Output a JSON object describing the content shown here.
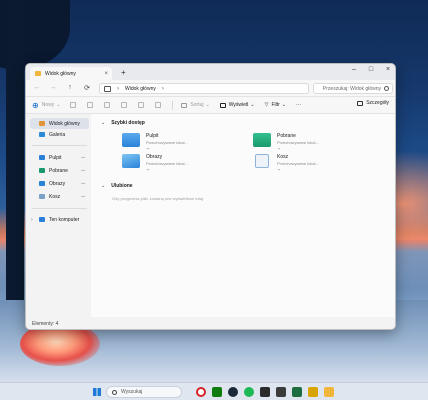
{
  "window": {
    "tab_title": "Widok główny",
    "nav": {
      "back": "←",
      "forward": "→",
      "up": "↑",
      "refresh": "⟳"
    },
    "address": {
      "segment": "Widok główny"
    },
    "search_placeholder": "Przeszukaj: Widok główny"
  },
  "toolbar": {
    "new_label": "Nowy",
    "sort_label": "Sortuj",
    "view_label": "Wyświetl",
    "filter_label": "Filtr",
    "more_label": "···",
    "details_label": "Szczegóły"
  },
  "sidebar": {
    "items": [
      {
        "label": "Widok główny",
        "icon": "home-icon",
        "color": "#e0953a"
      },
      {
        "label": "Galeria",
        "icon": "gallery-icon",
        "color": "#2b8bd6"
      },
      {
        "label": "Pulpit",
        "icon": "desktop-icon",
        "color": "#2a82d8"
      },
      {
        "label": "Pobrane",
        "icon": "download-icon",
        "color": "#1a9a6c"
      },
      {
        "label": "Obrazy",
        "icon": "pictures-icon",
        "color": "#2a82d8"
      },
      {
        "label": "Kosz",
        "icon": "recycle-bin-icon",
        "color": "#7aa0c8"
      },
      {
        "label": "Ten komputer",
        "icon": "computer-icon",
        "color": "#2a82d8"
      }
    ]
  },
  "main": {
    "quick_access": {
      "title": "Szybki dostęp",
      "items": [
        {
          "name": "Pulpit",
          "sub": "Przechowywane lokal...",
          "color": "#2a82d8"
        },
        {
          "name": "Pobrane",
          "sub": "Przechowywane lokal...",
          "color": "#1a9a6c"
        },
        {
          "name": "Obrazy",
          "sub": "Przechowywane lokal...",
          "color": "#2a82d8"
        },
        {
          "name": "Kosz",
          "sub": "Przechowywane lokal...",
          "color": "#8fb4da"
        }
      ],
      "pin_glyph": "⊸"
    },
    "favorites": {
      "title": "Ulubione",
      "empty_text": "Gdy przypniesz pliki, zostaną one wyświetlone tutaj."
    }
  },
  "status": {
    "text": "Elementy: 4"
  },
  "taskbar": {
    "search_placeholder": "Wyszukaj",
    "apps": [
      {
        "name": "opera-icon",
        "color": "#d8232a"
      },
      {
        "name": "xbox-icon",
        "color": "#107c10"
      },
      {
        "name": "steam-icon",
        "color": "#1b2838"
      },
      {
        "name": "spotify-icon",
        "color": "#1db954"
      },
      {
        "name": "app-icon",
        "color": "#2b2b2b"
      },
      {
        "name": "excel-icon",
        "color": "#1d6f42"
      },
      {
        "name": "tool-icon",
        "color": "#d9a400"
      },
      {
        "name": "file-explorer-icon",
        "color": "#f0b53a"
      }
    ]
  }
}
